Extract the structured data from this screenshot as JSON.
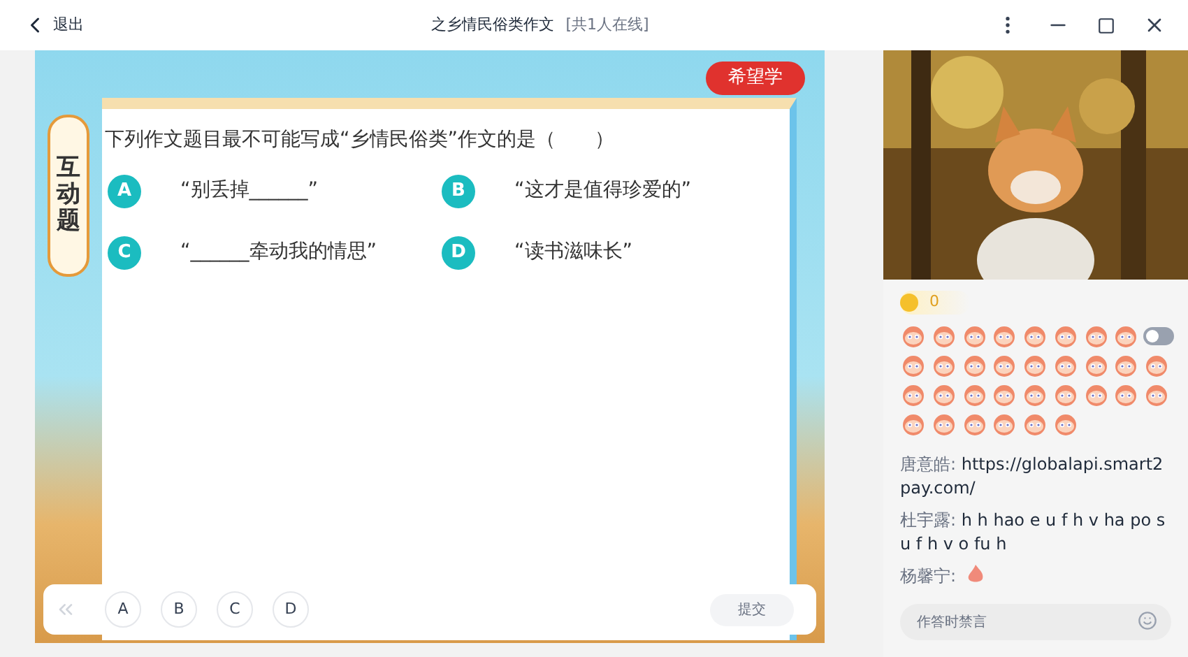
{
  "topbar": {
    "back_label": "退出",
    "title": "之乡情民俗类作文",
    "online": "[共1人在线]"
  },
  "slide": {
    "brand": "希望学",
    "side_tab": "互动题",
    "question": "下列作文题目最不可能写成“乡情民俗类”作文的是（　　）",
    "options": [
      {
        "letter": "A",
        "text": "“别丢掉______”"
      },
      {
        "letter": "B",
        "text": "“这才是值得珍爱的”"
      },
      {
        "letter": "C",
        "text": "“______牵动我的情思”"
      },
      {
        "letter": "D",
        "text": "“读书滋味长”"
      }
    ]
  },
  "answer_bar": {
    "choices": [
      {
        "label": "A",
        "selected": false
      },
      {
        "label": "B",
        "selected": false
      },
      {
        "label": "C",
        "selected": false
      },
      {
        "label": "D",
        "selected": false
      }
    ],
    "submit": {
      "label": "提交",
      "disabled": true
    }
  },
  "coins": "0",
  "sticker_toggle": {
    "on": false
  },
  "chat": [
    {
      "name": "唐意皓:",
      "kind": "text",
      "message": "https://globalapi.smart2pay.com/"
    },
    {
      "name": "杜宇露:",
      "kind": "text",
      "message": "h h hao e u f h v ha po su f h v o fu h"
    },
    {
      "name": "杨馨宁:",
      "kind": "emoji"
    }
  ],
  "chat_input": {
    "placeholder": "作答时禁言"
  }
}
